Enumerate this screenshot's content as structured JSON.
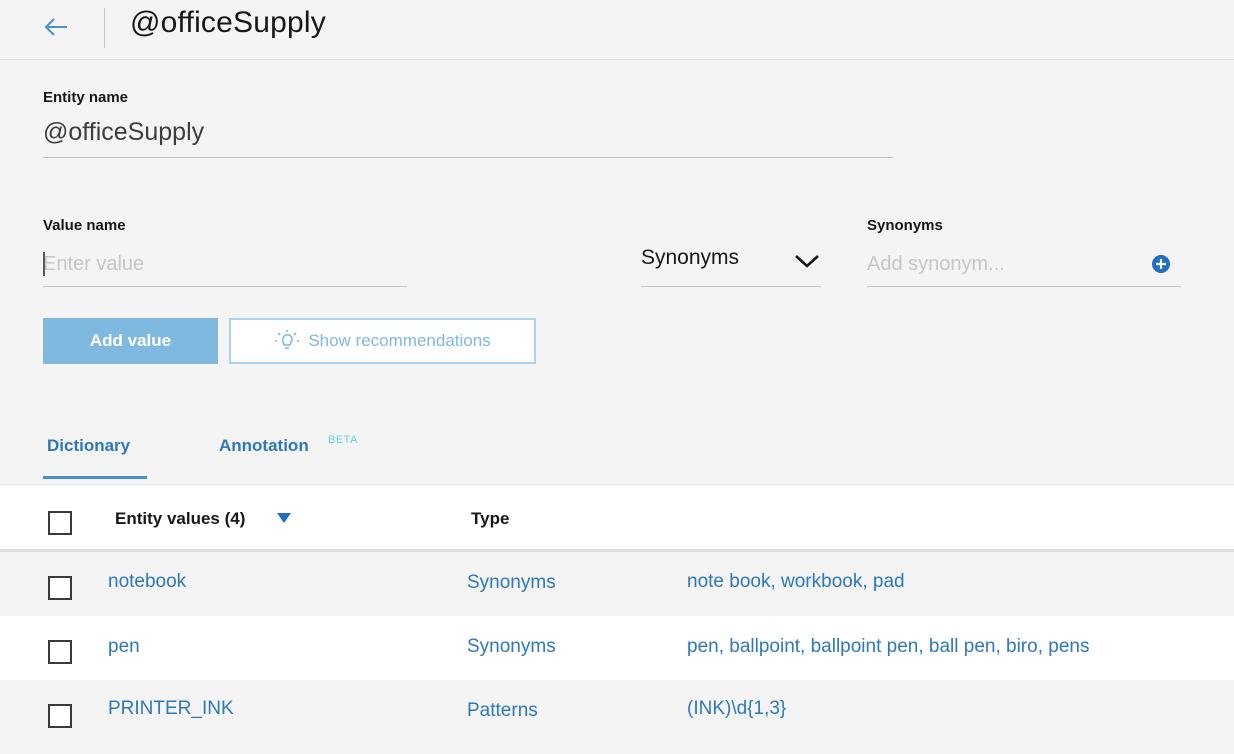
{
  "header": {
    "title": "@officeSupply"
  },
  "entity": {
    "label": "Entity name",
    "value": "@officeSupply"
  },
  "value_form": {
    "value_label": "Value name",
    "value_placeholder": "Enter value",
    "type_selected": "Synonyms",
    "synonyms_label": "Synonyms",
    "synonyms_placeholder": "Add synonym...",
    "add_value_label": "Add value",
    "recommendations_label": "Show recommendations"
  },
  "tabs": [
    {
      "label": "Dictionary",
      "active": true
    },
    {
      "label": "Annotation",
      "badge": "BETA",
      "active": false
    }
  ],
  "table": {
    "headers": {
      "values": "Entity values (4)",
      "type": "Type"
    },
    "rows": [
      {
        "value": "notebook",
        "type": "Synonyms",
        "details": "note book, workbook, pad"
      },
      {
        "value": "pen",
        "type": "Synonyms",
        "details": "pen, ballpoint, ballpoint pen, ball pen, biro, pens"
      },
      {
        "value": "PRINTER_INK",
        "type": "Patterns",
        "details": "(INK)\\d{1,3}"
      }
    ]
  },
  "colors": {
    "accent": "#2e78b8",
    "primary_button": "#7fb9e0",
    "beta": "#5fd3e0"
  }
}
